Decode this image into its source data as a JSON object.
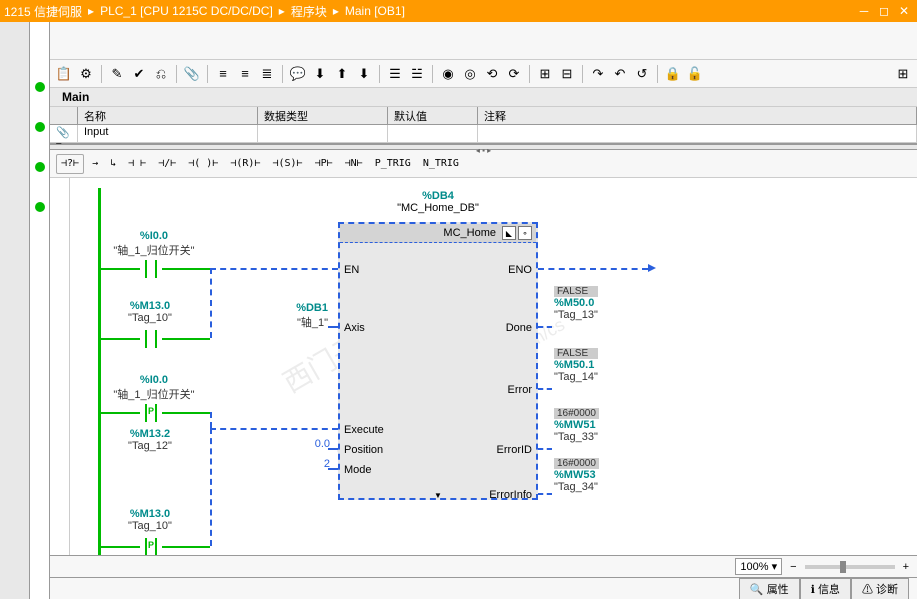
{
  "title": {
    "project": "1215 信捷伺服",
    "plc": "PLC_1 [CPU 1215C DC/DC/DC]",
    "folder": "程序块",
    "block": "Main [OB1]"
  },
  "block_header": "Main",
  "var_table": {
    "col_name": "名称",
    "col_type": "数据类型",
    "col_default": "默认值",
    "col_comment": "注释",
    "row_input": "Input"
  },
  "lad_btns": {
    "q": "⊣?⊢",
    "arrow": "→",
    "branch": "↳",
    "no": "⊣ ⊢",
    "nc": "⊣/⊢",
    "coil": "⊣( )⊢",
    "r": "⊣(R)⊢",
    "s": "⊣(S)⊢",
    "p": "⊣P⊢",
    "n": "⊣N⊢",
    "ptrig": "P_TRIG",
    "ntrig": "N_TRIG"
  },
  "db_label": {
    "addr": "%DB4",
    "name": "\"MC_Home_DB\""
  },
  "fb": {
    "name": "MC_Home",
    "ports": {
      "en": "EN",
      "eno": "ENO",
      "axis": "Axis",
      "done": "Done",
      "execute": "Execute",
      "error": "Error",
      "position": "Position",
      "errorid": "ErrorID",
      "mode": "Mode",
      "errorinfo": "ErrorInfo"
    }
  },
  "contacts": {
    "c1": {
      "addr": "%I0.0",
      "name": "\"轴_1_归位开关\""
    },
    "c2": {
      "addr": "%M13.0",
      "name": "\"Tag_10\""
    },
    "c3": {
      "addr": "%I0.0",
      "name": "\"轴_1_归位开关\""
    },
    "c4": {
      "addr": "%M13.2",
      "name": "\"Tag_12\""
    },
    "c5": {
      "addr": "%M13.0",
      "name": "\"Tag_10\""
    }
  },
  "inputs": {
    "axis": {
      "addr": "%DB1",
      "name": "\"轴_1\""
    },
    "position": "0.0",
    "mode": "2"
  },
  "outputs": {
    "done": {
      "val": "FALSE",
      "addr": "%M50.0",
      "name": "\"Tag_13\""
    },
    "error": {
      "val": "FALSE",
      "addr": "%M50.1",
      "name": "\"Tag_14\""
    },
    "errorid": {
      "val": "16#0000",
      "addr": "%MW51",
      "name": "\"Tag_33\""
    },
    "errorinfo": {
      "val": "16#0000",
      "addr": "%MW53",
      "name": "\"Tag_34\""
    }
  },
  "zoom": "100%",
  "tabs": {
    "props": "属性",
    "info": "信息",
    "diag": "诊断"
  },
  "watermark1": "西门子工业找答案",
  "watermark2": "support.industry.siemens.com/cs"
}
